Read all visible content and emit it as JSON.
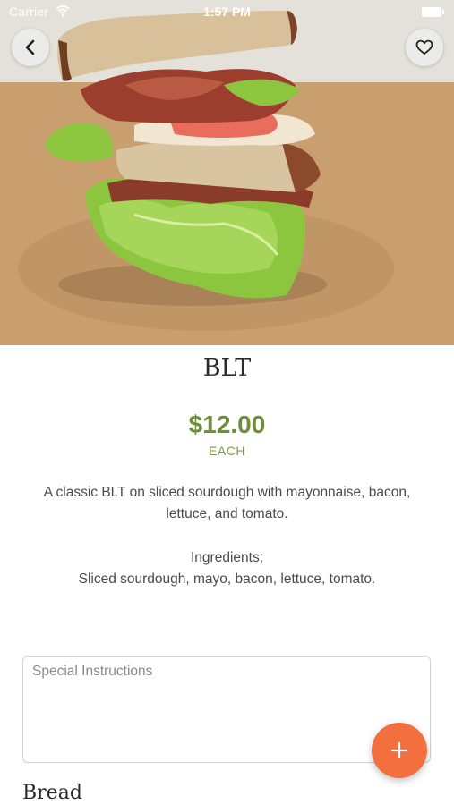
{
  "status_bar": {
    "carrier": "Carrier",
    "time": "1:57 PM"
  },
  "nav": {
    "back_icon": "chevron-left-icon",
    "favorite_icon": "heart-outline-icon"
  },
  "product": {
    "image_subject": "BLT sandwich",
    "name": "BLT",
    "price": "$12.00",
    "unit": "EACH",
    "description": "A classic BLT on sliced sourdough with mayonnaise, bacon, lettuce, and tomato.",
    "ingredients_label": "Ingredients;",
    "ingredients": "Sliced sourdough, mayo, bacon, lettuce, tomato."
  },
  "special_instructions": {
    "placeholder": "Special Instructions",
    "value": ""
  },
  "add_button": {
    "icon": "plus-icon"
  },
  "options": {
    "section_title": "Bread"
  },
  "colors": {
    "price_green": "#6f8d3a",
    "accent_orange": "#f36f3e",
    "text_dark": "#2b2b2b",
    "text_body": "#4a4a4a"
  }
}
